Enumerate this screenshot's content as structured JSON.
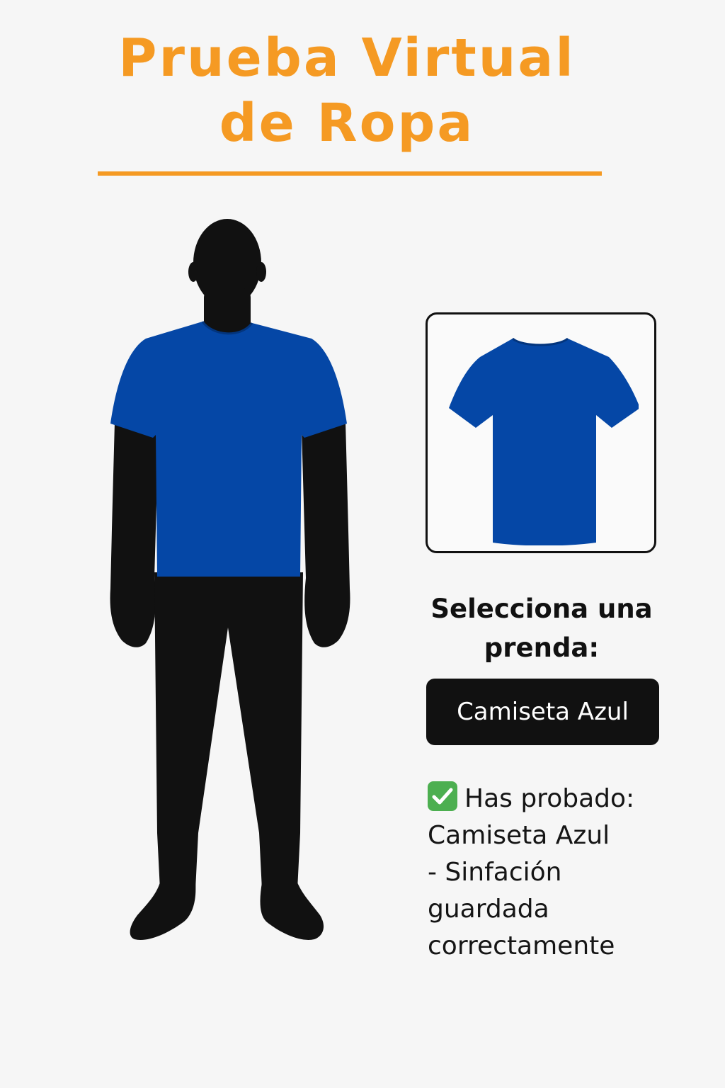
{
  "header": {
    "title_line1": "Prueba Virtual",
    "title_line2": "de Ropa"
  },
  "preview": {
    "garment_icon": "t-shirt-icon",
    "garment_color": "#0547a6"
  },
  "selector": {
    "label_line1": "Selecciona una",
    "label_line2": "prenda:",
    "selected_value": "Camiseta Azul"
  },
  "status": {
    "icon": "check-icon",
    "lines": [
      "Has probado:",
      "Camiseta Azul",
      "- Sinfación",
      "guardada",
      "correctamente"
    ]
  },
  "colors": {
    "accent": "#f59a23",
    "silhouette": "#111111",
    "shirt": "#0547a6",
    "success": "#4caf50"
  }
}
